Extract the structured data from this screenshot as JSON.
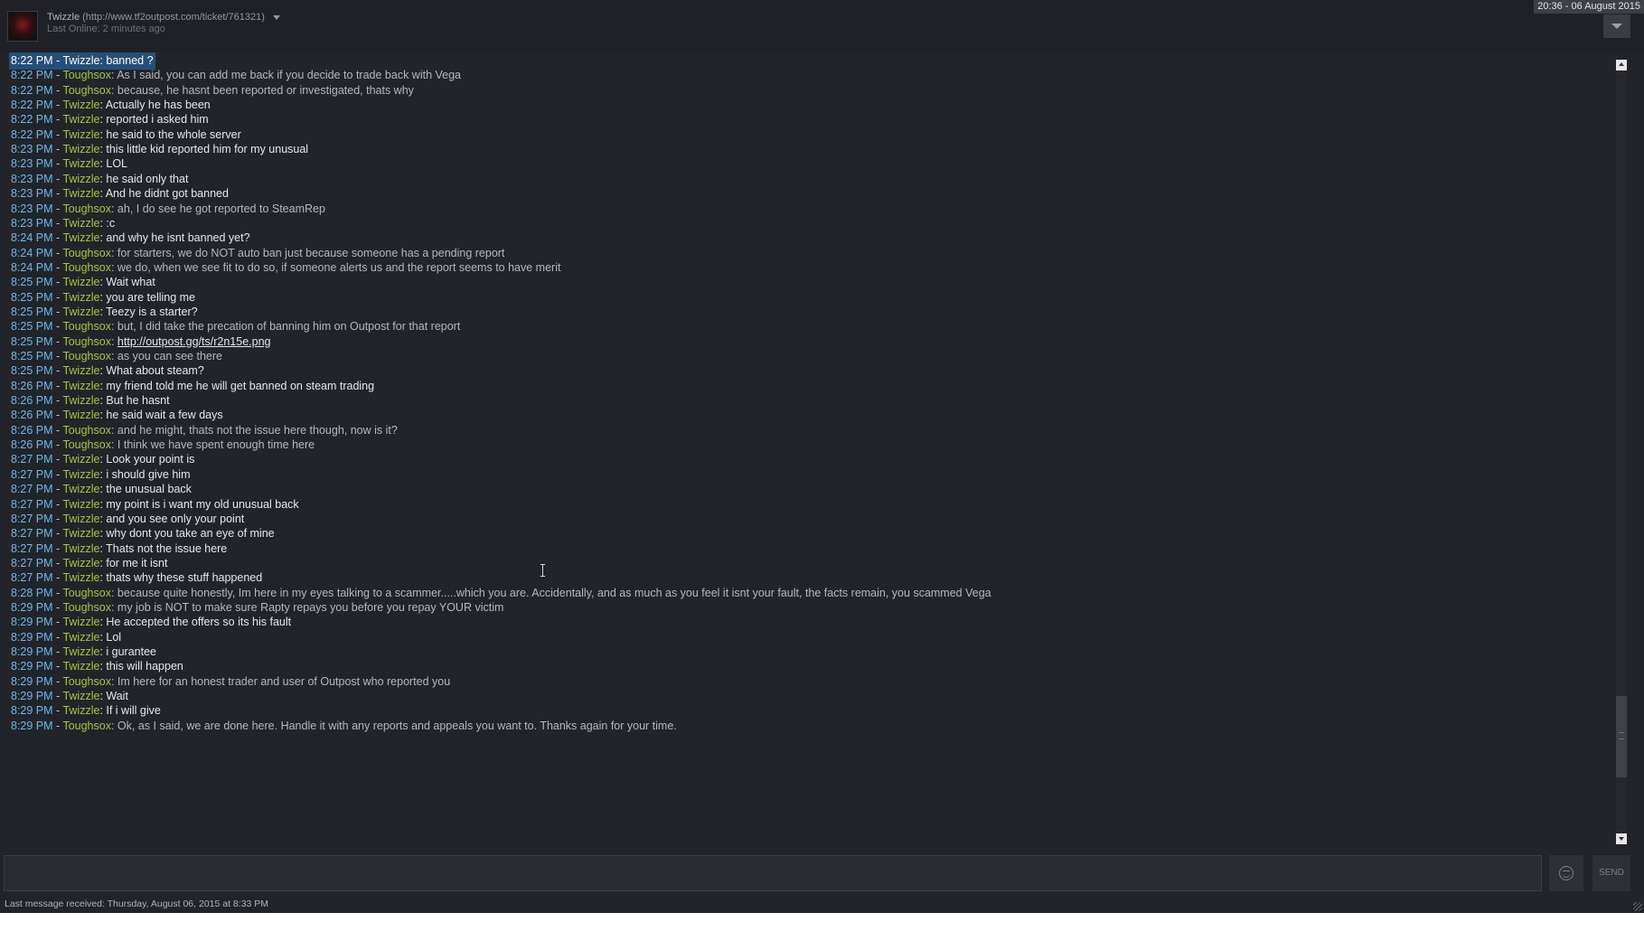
{
  "header": {
    "name": "Twizzle",
    "name_suffix": " (http://www.tf2outpost.com/ticket/761321)",
    "last_online": "Last Online: 2 minutes ago",
    "clock": "20:36 - 06 August 2015"
  },
  "messages": [
    {
      "time": "8:22 PM",
      "sep": " - ",
      "sender": "Twizzle",
      "text": ": banned ?",
      "from": "them"
    },
    {
      "time": "8:22 PM",
      "sep": " - ",
      "sender": "Toughsox",
      "text": ": As I said, you can add me back if you decide to trade back with Vega",
      "from": "me"
    },
    {
      "time": "8:22 PM",
      "sep": " - ",
      "sender": "Toughsox",
      "text": ": because, he hasnt been reported or investigated, thats why",
      "from": "me"
    },
    {
      "time": "8:22 PM",
      "sep": " - ",
      "sender": "Twizzle",
      "text": ": Actually he has been",
      "from": "them"
    },
    {
      "time": "8:22 PM",
      "sep": " - ",
      "sender": "Twizzle",
      "text": ": reported i asked him",
      "from": "them"
    },
    {
      "time": "8:22 PM",
      "sep": " - ",
      "sender": "Twizzle",
      "text": ": he said to the whole server",
      "from": "them"
    },
    {
      "time": "8:23 PM",
      "sep": " - ",
      "sender": "Twizzle",
      "text": ": this little kid reported him for my unusual",
      "from": "them"
    },
    {
      "time": "8:23 PM",
      "sep": " - ",
      "sender": "Twizzle",
      "text": ": LOL",
      "from": "them"
    },
    {
      "time": "8:23 PM",
      "sep": " - ",
      "sender": "Twizzle",
      "text": ": he said only that",
      "from": "them"
    },
    {
      "time": "8:23 PM",
      "sep": " - ",
      "sender": "Twizzle",
      "text": ": And he didnt got banned",
      "from": "them"
    },
    {
      "time": "8:23 PM",
      "sep": " - ",
      "sender": "Toughsox",
      "text": ": ah, I do see he got reported to SteamRep",
      "from": "me"
    },
    {
      "time": "8:23 PM",
      "sep": " - ",
      "sender": "Twizzle",
      "text": ": :c",
      "from": "them"
    },
    {
      "time": "8:24 PM",
      "sep": " - ",
      "sender": "Twizzle",
      "text": ": and why he isnt banned yet?",
      "from": "them"
    },
    {
      "time": "8:24 PM",
      "sep": " - ",
      "sender": "Toughsox",
      "text": ": for starters, we do NOT auto ban just because someone has a pending report",
      "from": "me"
    },
    {
      "time": "8:24 PM",
      "sep": " - ",
      "sender": "Toughsox",
      "text": ": we do, when we see fit to do so, if someone alerts us and the report seems to have merit",
      "from": "me"
    },
    {
      "time": "8:25 PM",
      "sep": " - ",
      "sender": "Twizzle",
      "text": ": Wait what",
      "from": "them"
    },
    {
      "time": "8:25 PM",
      "sep": " - ",
      "sender": "Twizzle",
      "text": ": you are telling me",
      "from": "them"
    },
    {
      "time": "8:25 PM",
      "sep": " - ",
      "sender": "Twizzle",
      "text": ": Teezy is a starter?",
      "from": "them"
    },
    {
      "time": "8:25 PM",
      "sep": " - ",
      "sender": "Toughsox",
      "text": ": but, I did take the precation of banning him on Outpost for that report",
      "from": "me"
    },
    {
      "time": "8:25 PM",
      "sep": " - ",
      "sender": "Toughsox",
      "text": ": ",
      "link": "http://outpost.gg/ts/r2n15e.png",
      "from": "me"
    },
    {
      "time": "8:25 PM",
      "sep": " - ",
      "sender": "Toughsox",
      "text": ": as you can see there",
      "from": "me"
    },
    {
      "time": "8:25 PM",
      "sep": " - ",
      "sender": "Twizzle",
      "text": ": What about steam?",
      "from": "them"
    },
    {
      "time": "8:26 PM",
      "sep": " - ",
      "sender": "Twizzle",
      "text": ": my friend told me he will get banned on steam trading",
      "from": "them"
    },
    {
      "time": "8:26 PM",
      "sep": " - ",
      "sender": "Twizzle",
      "text": ": But he hasnt",
      "from": "them"
    },
    {
      "time": "8:26 PM",
      "sep": " - ",
      "sender": "Twizzle",
      "text": ": he said wait a few days",
      "from": "them"
    },
    {
      "time": "8:26 PM",
      "sep": " - ",
      "sender": "Toughsox",
      "text": ": and he might, thats not the issue here though, now is it?",
      "from": "me"
    },
    {
      "time": "8:26 PM",
      "sep": " - ",
      "sender": "Toughsox",
      "text": ": I think we have spent enough time here",
      "from": "me"
    },
    {
      "time": "8:27 PM",
      "sep": " - ",
      "sender": "Twizzle",
      "text": ": Look your point is",
      "from": "them"
    },
    {
      "time": "8:27 PM",
      "sep": " - ",
      "sender": "Twizzle",
      "text": ": i should  give him",
      "from": "them"
    },
    {
      "time": "8:27 PM",
      "sep": " - ",
      "sender": "Twizzle",
      "text": ": the unusual back",
      "from": "them"
    },
    {
      "time": "8:27 PM",
      "sep": " - ",
      "sender": "Twizzle",
      "text": ": my point is i want my old unusual back",
      "from": "them"
    },
    {
      "time": "8:27 PM",
      "sep": " - ",
      "sender": "Twizzle",
      "text": ": and you see only your point",
      "from": "them"
    },
    {
      "time": "8:27 PM",
      "sep": " - ",
      "sender": "Twizzle",
      "text": ": why dont you take an eye of mine",
      "from": "them"
    },
    {
      "time": "8:27 PM",
      "sep": " - ",
      "sender": "Twizzle",
      "text": ": Thats not the issue here",
      "from": "them"
    },
    {
      "time": "8:27 PM",
      "sep": " - ",
      "sender": "Twizzle",
      "text": ": for me it isnt",
      "from": "them"
    },
    {
      "time": "8:27 PM",
      "sep": " - ",
      "sender": "Twizzle",
      "text": ": thats why these stuff happened",
      "from": "them"
    },
    {
      "time": "8:28 PM",
      "sep": " - ",
      "sender": "Toughsox",
      "text": ": because quite honestly, Im here in my eyes talking to a scammer.....which you are. Accidentally, and as much as you feel it isnt your fault, the facts remain, you scammed Vega",
      "from": "me"
    },
    {
      "time": "8:29 PM",
      "sep": " - ",
      "sender": "Toughsox",
      "text": ": my job is NOT to make sure Rapty repays you before you repay YOUR victim",
      "from": "me"
    },
    {
      "time": "8:29 PM",
      "sep": " - ",
      "sender": "Twizzle",
      "text": ": He accepted the offers so its his fault",
      "from": "them"
    },
    {
      "time": "8:29 PM",
      "sep": " - ",
      "sender": "Twizzle",
      "text": ": Lol",
      "from": "them"
    },
    {
      "time": "8:29 PM",
      "sep": " - ",
      "sender": "Twizzle",
      "text": ": i gurantee",
      "from": "them"
    },
    {
      "time": "8:29 PM",
      "sep": " - ",
      "sender": "Twizzle",
      "text": ": this will happen",
      "from": "them"
    },
    {
      "time": "8:29 PM",
      "sep": " - ",
      "sender": "Toughsox",
      "text": ": Im here for an honest trader and user of Outpost who reported you",
      "from": "me"
    },
    {
      "time": "8:29 PM",
      "sep": " - ",
      "sender": "Twizzle",
      "text": ": Wait",
      "from": "them"
    },
    {
      "time": "8:29 PM",
      "sep": " - ",
      "sender": "Twizzle",
      "text": ": If i will give",
      "from": "them"
    },
    {
      "time": "8:29 PM",
      "sep": " - ",
      "sender": "Toughsox",
      "text": ": Ok, as I said, we are done here. Handle it with any reports and appeals you want to. Thanks again for your time.",
      "from": "me"
    }
  ],
  "input": {
    "value": "",
    "send_label": "SEND"
  },
  "status": {
    "last_message": "Last message received: Thursday, August 06, 2015 at 8:33 PM"
  },
  "icons": {
    "avatar": "avatar-image",
    "dropdown": "caret-down-icon",
    "collapse": "chevron-down-icon",
    "emoticon": "emoticon-icon",
    "resize": "resize-grip-icon"
  },
  "colors": {
    "background": "#22242a",
    "timestamp": "#6fb8ea",
    "sender": "#a4c742",
    "message_text": "#e6e8ea",
    "selection": "#264f78"
  }
}
